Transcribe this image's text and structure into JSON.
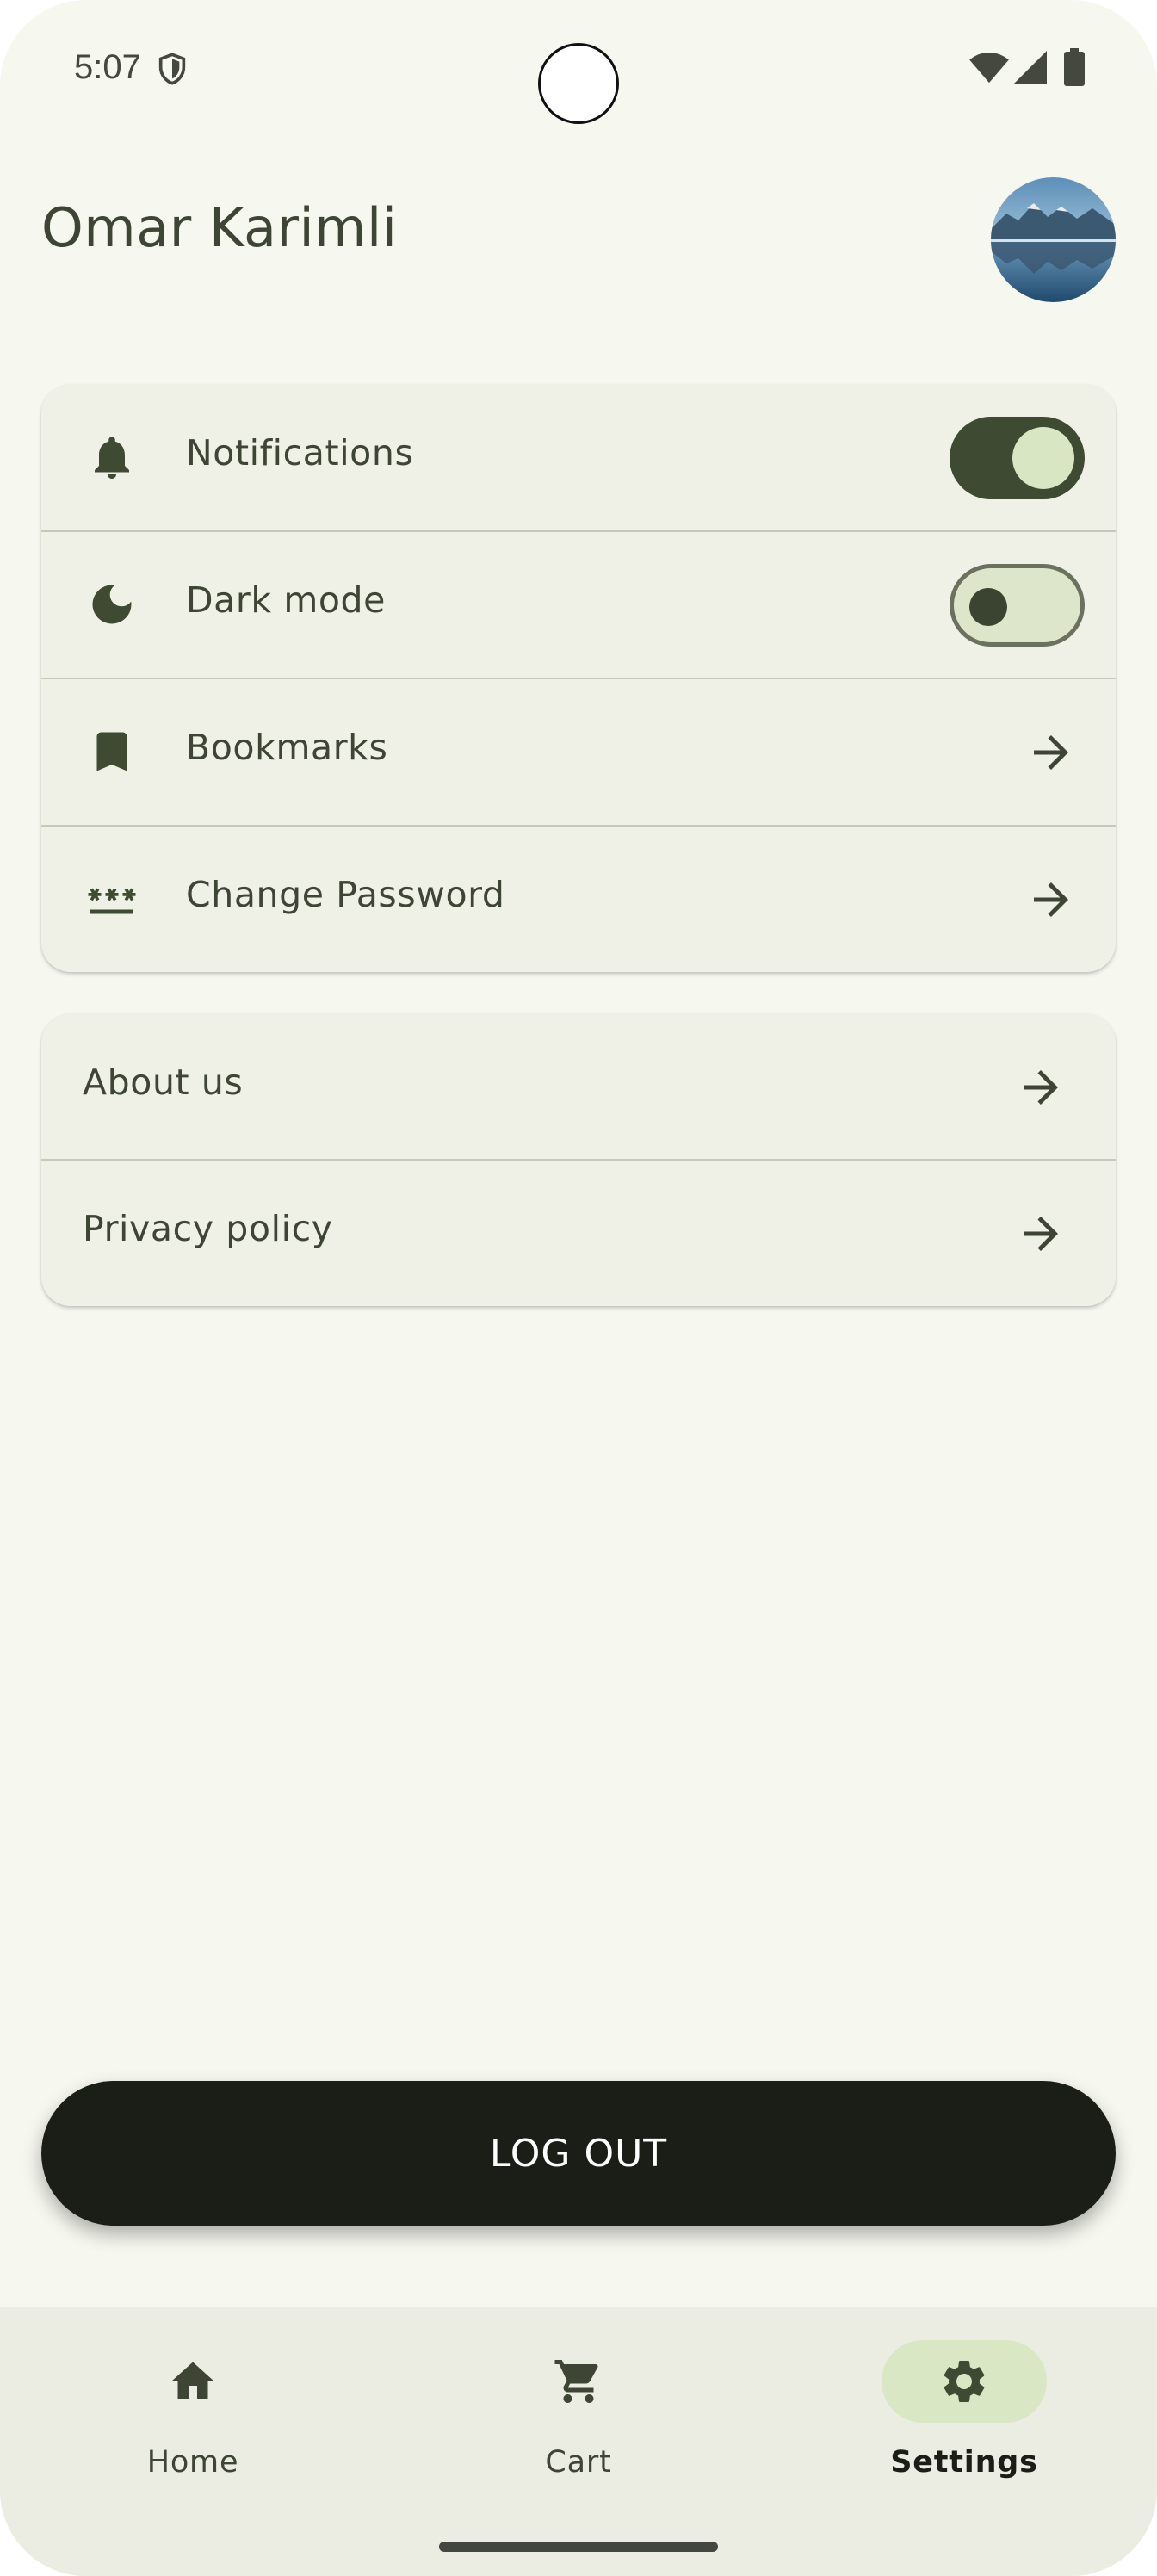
{
  "status_bar": {
    "time": "5:07",
    "icons": [
      "shield-icon",
      "wifi-icon",
      "signal-icon",
      "battery-icon"
    ]
  },
  "header": {
    "title": "Omar Karimli",
    "avatar": "avatar-mountain-lake"
  },
  "settings_card": {
    "items": [
      {
        "label": "Notifications",
        "icon": "bell-icon",
        "control": "toggle",
        "on": true
      },
      {
        "label": "Dark mode",
        "icon": "moon-icon",
        "control": "toggle",
        "on": false
      },
      {
        "label": "Bookmarks",
        "icon": "bookmark-icon",
        "control": "arrow-icon"
      },
      {
        "label": "Change Password",
        "icon": "password-icon",
        "control": "arrow-icon"
      }
    ]
  },
  "info_card": {
    "items": [
      {
        "label": "About us",
        "control": "arrow-icon"
      },
      {
        "label": "Privacy policy",
        "control": "arrow-icon"
      }
    ]
  },
  "logout": {
    "label": "LOG OUT"
  },
  "bottom_nav": {
    "items": [
      {
        "label": "Home",
        "icon": "home-icon",
        "active": false
      },
      {
        "label": "Cart",
        "icon": "cart-icon",
        "active": false
      },
      {
        "label": "Settings",
        "icon": "gear-icon",
        "active": true
      }
    ]
  },
  "colors": {
    "background": "#f6f7ef",
    "card": "#eff0e6",
    "text": "#3e4535",
    "toggle_on": "#3e4a32",
    "active_pill": "#d9e7c5",
    "logout_button": "#1b1d17"
  }
}
